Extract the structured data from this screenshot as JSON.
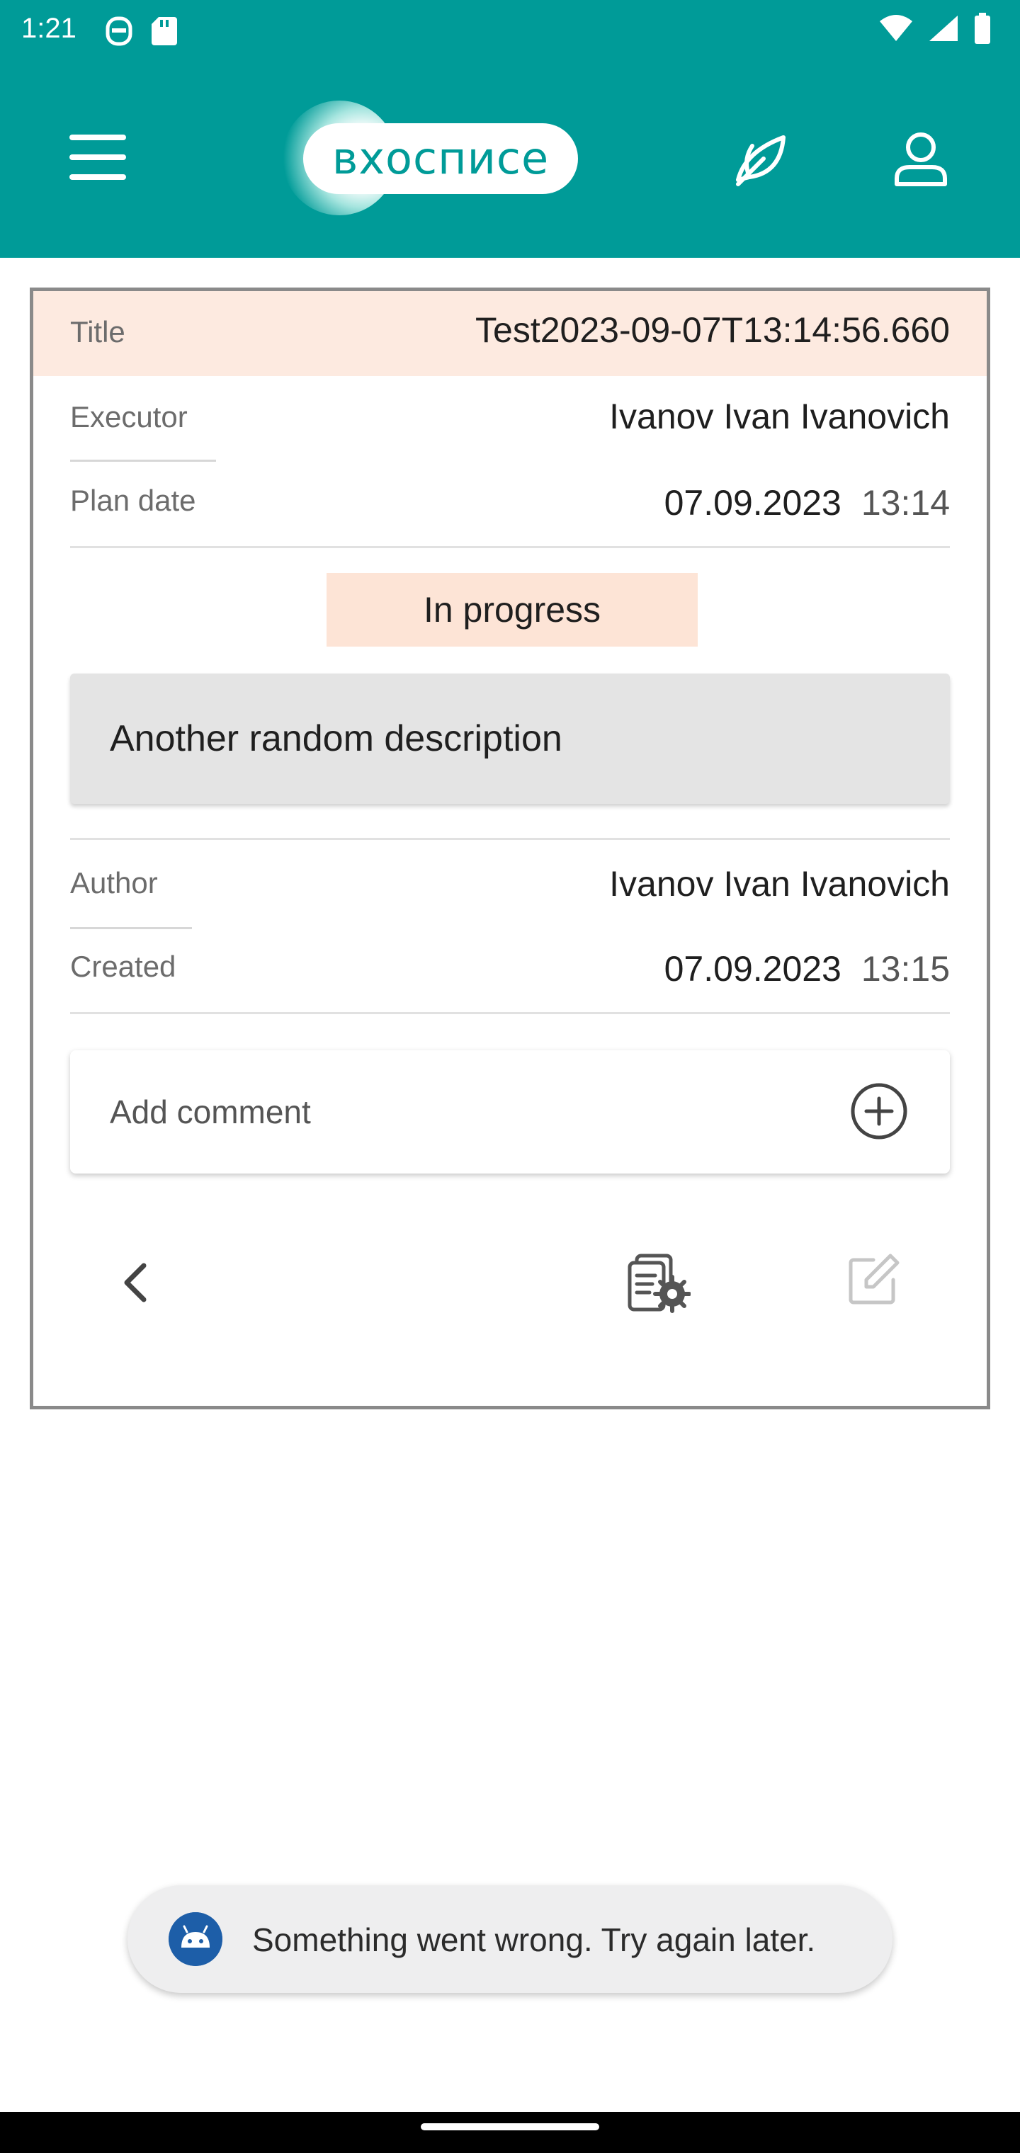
{
  "status_bar": {
    "time": "1:21"
  },
  "app_bar": {
    "logo_text": "вхосписе"
  },
  "task": {
    "title_label": "Title",
    "title_value": "Test2023-09-07T13:14:56.660",
    "executor_label": "Executor",
    "executor_value": "Ivanov Ivan Ivanovich",
    "plan_date_label": "Plan date",
    "plan_date": "07.09.2023",
    "plan_time": "13:14",
    "status": "In progress",
    "description": "Another random description",
    "author_label": "Author",
    "author_value": "Ivanov Ivan Ivanovich",
    "created_label": "Created",
    "created_date": "07.09.2023",
    "created_time": "13:15"
  },
  "comment": {
    "label": "Add comment"
  },
  "toast": {
    "message": "Something went wrong. Try again later."
  },
  "colors": {
    "accent": "#009b98",
    "title_bg": "#fdeae0",
    "status_bg": "#fde4d6"
  }
}
